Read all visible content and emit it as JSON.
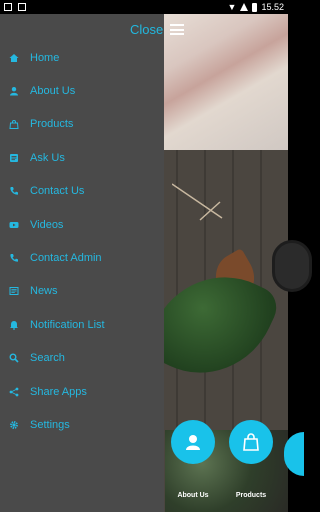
{
  "status_bar": {
    "time": "15.52"
  },
  "drawer": {
    "close_label": "Close",
    "items": [
      {
        "label": "Home",
        "icon": "home-icon"
      },
      {
        "label": "About Us",
        "icon": "person-icon"
      },
      {
        "label": "Products",
        "icon": "bag-icon"
      },
      {
        "label": "Ask Us",
        "icon": "message-icon"
      },
      {
        "label": "Contact Us",
        "icon": "phone-icon"
      },
      {
        "label": "Videos",
        "icon": "youtube-icon"
      },
      {
        "label": "Contact Admin",
        "icon": "phone-icon"
      },
      {
        "label": "News",
        "icon": "newspaper-icon"
      },
      {
        "label": "Notification List",
        "icon": "bell-icon"
      },
      {
        "label": "Search",
        "icon": "search-icon"
      },
      {
        "label": "Share Apps",
        "icon": "share-icon"
      },
      {
        "label": "Settings",
        "icon": "gear-icon"
      }
    ]
  },
  "bottom_buttons": [
    {
      "label": "About Us",
      "icon": "person-icon"
    },
    {
      "label": "Products",
      "icon": "bag-icon"
    }
  ],
  "colors": {
    "accent": "#22b8df",
    "drawer_bg": "#4a4a4a",
    "fab_bg": "#19c2ea"
  }
}
